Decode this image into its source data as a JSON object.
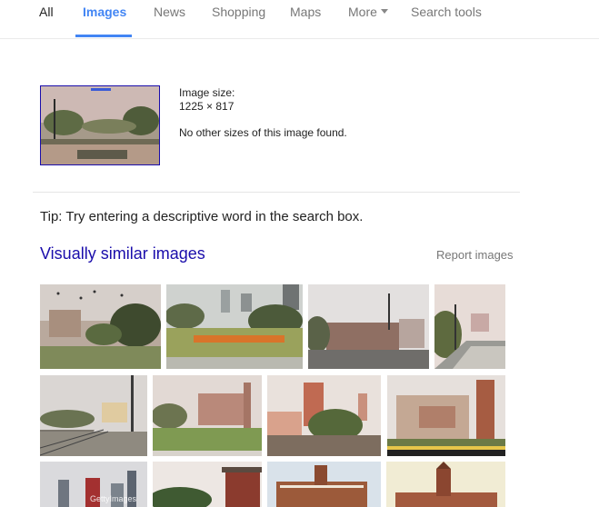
{
  "nav": {
    "all": "All",
    "images": "Images",
    "news": "News",
    "shopping": "Shopping",
    "maps": "Maps",
    "more": "More",
    "search_tools": "Search tools"
  },
  "source_image": {
    "size_label": "Image size:",
    "size_value": "1225 × 817",
    "other_sizes": "No other sizes of this image found."
  },
  "tip": "Tip: Try entering a descriptive word in the search box.",
  "similar": {
    "title": "Visually similar images",
    "report": "Report images",
    "watermark_row3_1": "GettyImages"
  },
  "colors": {
    "accent": "#4285f4",
    "link": "#1a0dab",
    "muted": "#777777"
  }
}
